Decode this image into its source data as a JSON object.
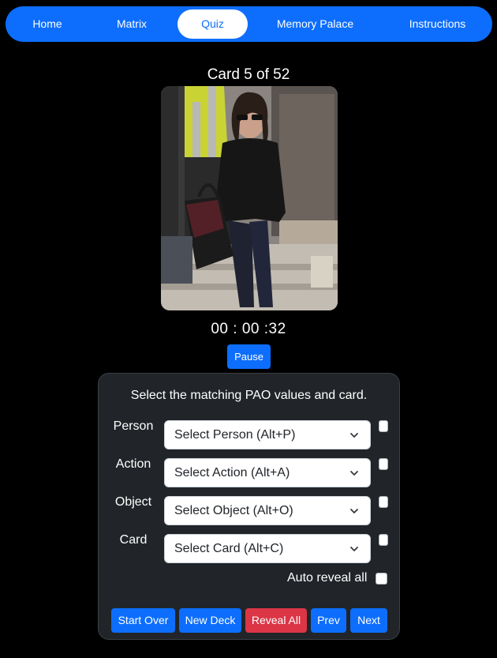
{
  "nav": {
    "items": [
      {
        "label": "Home",
        "active": false
      },
      {
        "label": "Matrix",
        "active": false
      },
      {
        "label": "Quiz",
        "active": true
      },
      {
        "label": "Memory Palace",
        "active": false
      },
      {
        "label": "Instructions",
        "active": false
      }
    ]
  },
  "card": {
    "counter": "Card 5 of 52"
  },
  "timer": {
    "display": "00 : 00 :32"
  },
  "pause": {
    "label": "Pause"
  },
  "panel": {
    "title": "Select the matching PAO values and card.",
    "fields": [
      {
        "label": "Person",
        "select": "Select Person (Alt+P)"
      },
      {
        "label": "Action",
        "select": "Select Action (Alt+A)"
      },
      {
        "label": "Object",
        "select": "Select Object (Alt+O)"
      },
      {
        "label": "Card",
        "select": "Select Card (Alt+C)"
      }
    ],
    "auto_reveal_label": "Auto reveal all",
    "buttons": [
      {
        "label": "Start Over",
        "color": "#0d6efd"
      },
      {
        "label": "New Deck",
        "color": "#0d6efd"
      },
      {
        "label": "Reveal All",
        "color": "#dc3545"
      },
      {
        "label": "Prev",
        "color": "#0d6efd"
      },
      {
        "label": "Next",
        "color": "#0d6efd"
      }
    ]
  },
  "colors": {
    "primary": "#0d6efd",
    "danger": "#dc3545",
    "panel_bg": "#212529"
  }
}
